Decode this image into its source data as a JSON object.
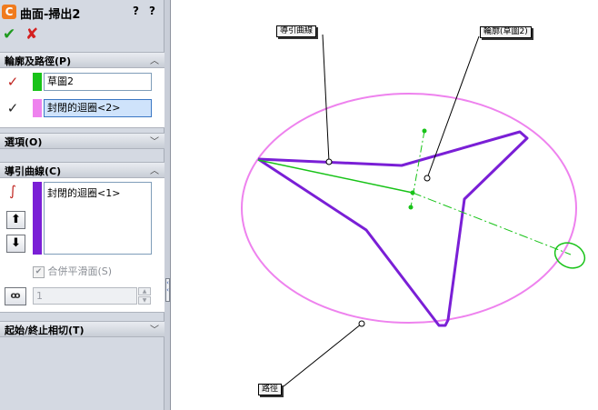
{
  "panel": {
    "title": "曲面-掃出2",
    "help_label": "?",
    "help2_label": "?",
    "ok_label": "✔",
    "cancel_label": "✘",
    "sections": {
      "profile_path": {
        "header": "輪廓及路徑(P)",
        "profile_value": "草圖2",
        "path_value": "封閉的迴圈<2>"
      },
      "options": {
        "header": "選項(O)"
      },
      "guide_curves": {
        "header": "導引曲線(C)",
        "items": [
          "封閉的迴圈<1>"
        ],
        "up_label": "⬆",
        "down_label": "⬇",
        "merge_label": "合併平滑面(S)",
        "merge_checked": true,
        "spin_value": "1"
      },
      "tangency": {
        "header": "起始/終止相切(T)"
      }
    }
  },
  "canvas": {
    "callouts": {
      "guide": "導引曲線",
      "profile": "輪廓(草圖2)",
      "path": "路徑"
    }
  },
  "colors": {
    "ellipse": "#ee82ee",
    "star": "#7a1fd6",
    "profile_green": "#18c318",
    "panel_bg": "#d4d9e2"
  }
}
